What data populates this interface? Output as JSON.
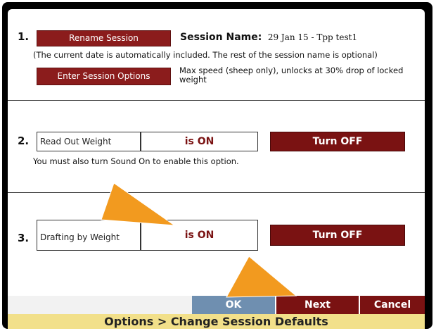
{
  "section1": {
    "number": "1.",
    "rename_button": "Rename Session",
    "session_name_label": "Session Name:",
    "session_name_value": "29 Jan 15  -  Tpp test1",
    "note": "(The current date is automatically included. The rest of the session name is optional)",
    "options_button": "Enter Session Options",
    "options_desc": "Max speed (sheep only), unlocks at 30% drop of locked weight"
  },
  "section2": {
    "number": "2.",
    "label": "Read Out Weight",
    "status": "is ON",
    "toggle": "Turn OFF",
    "note": "You must also turn Sound On to enable this option."
  },
  "section3": {
    "number": "3.",
    "label": "Drafting by Weight",
    "status": "is ON",
    "toggle": "Turn OFF"
  },
  "bottom": {
    "ok": "OK",
    "next": "Next",
    "cancel": "Cancel"
  },
  "footer": {
    "breadcrumb": "Options > Change Session Defaults"
  },
  "colors": {
    "button_red": "#8b1c1c",
    "ok_blue": "#6f8fb0",
    "footer_yellow": "#f2e08a",
    "arrow_orange": "#f29a1f"
  }
}
